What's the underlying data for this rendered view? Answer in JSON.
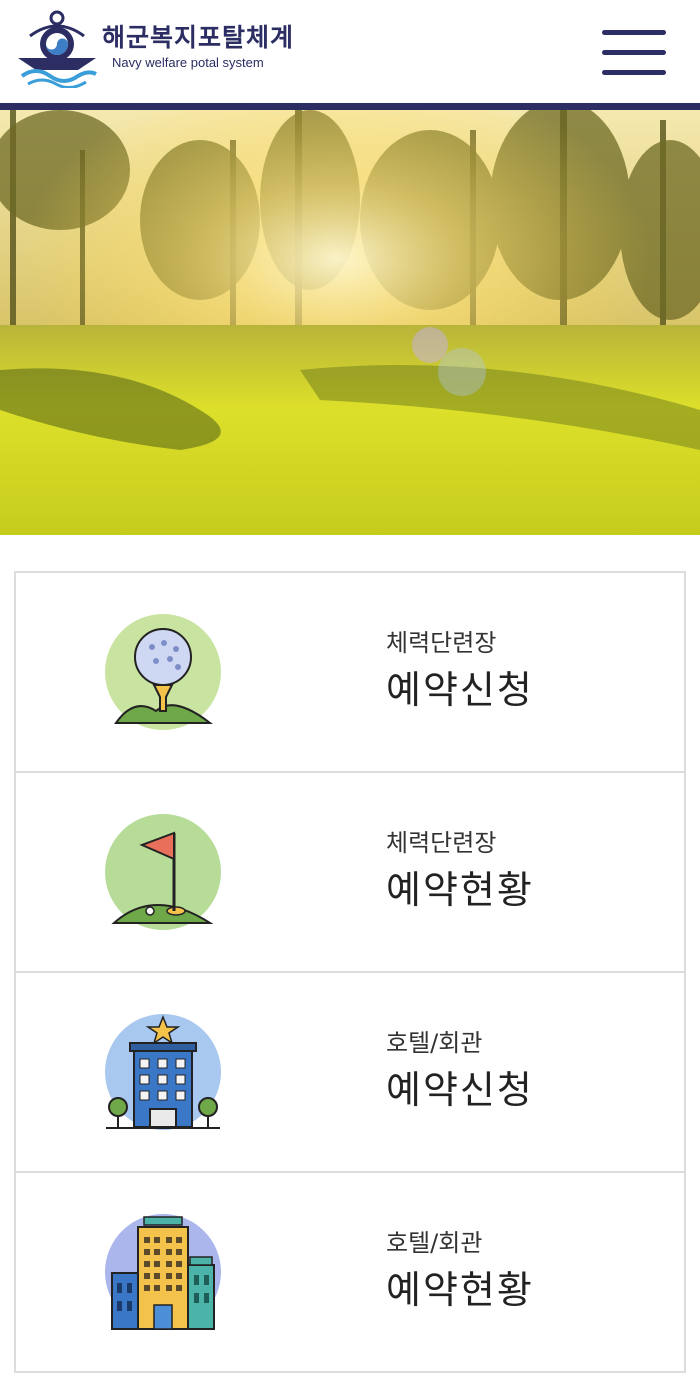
{
  "header": {
    "brand_ko": "해군복지포탈체계",
    "brand_en": "Navy welfare potal system",
    "logo_icon": "anchor-wave-logo",
    "menu_icon": "hamburger-menu-icon",
    "accent": "#2c2d63"
  },
  "hero": {
    "subject": "golf-course-sunset-photo"
  },
  "menu": [
    {
      "subtitle": "체력단련장",
      "title": "예약신청",
      "icon": "golf-ball-tee-icon"
    },
    {
      "subtitle": "체력단련장",
      "title": "예약현황",
      "icon": "golf-flag-icon"
    },
    {
      "subtitle": "호텔/회관",
      "title": "예약신청",
      "icon": "hotel-building-icon"
    },
    {
      "subtitle": "호텔/회관",
      "title": "예약현황",
      "icon": "tall-building-icon"
    }
  ]
}
